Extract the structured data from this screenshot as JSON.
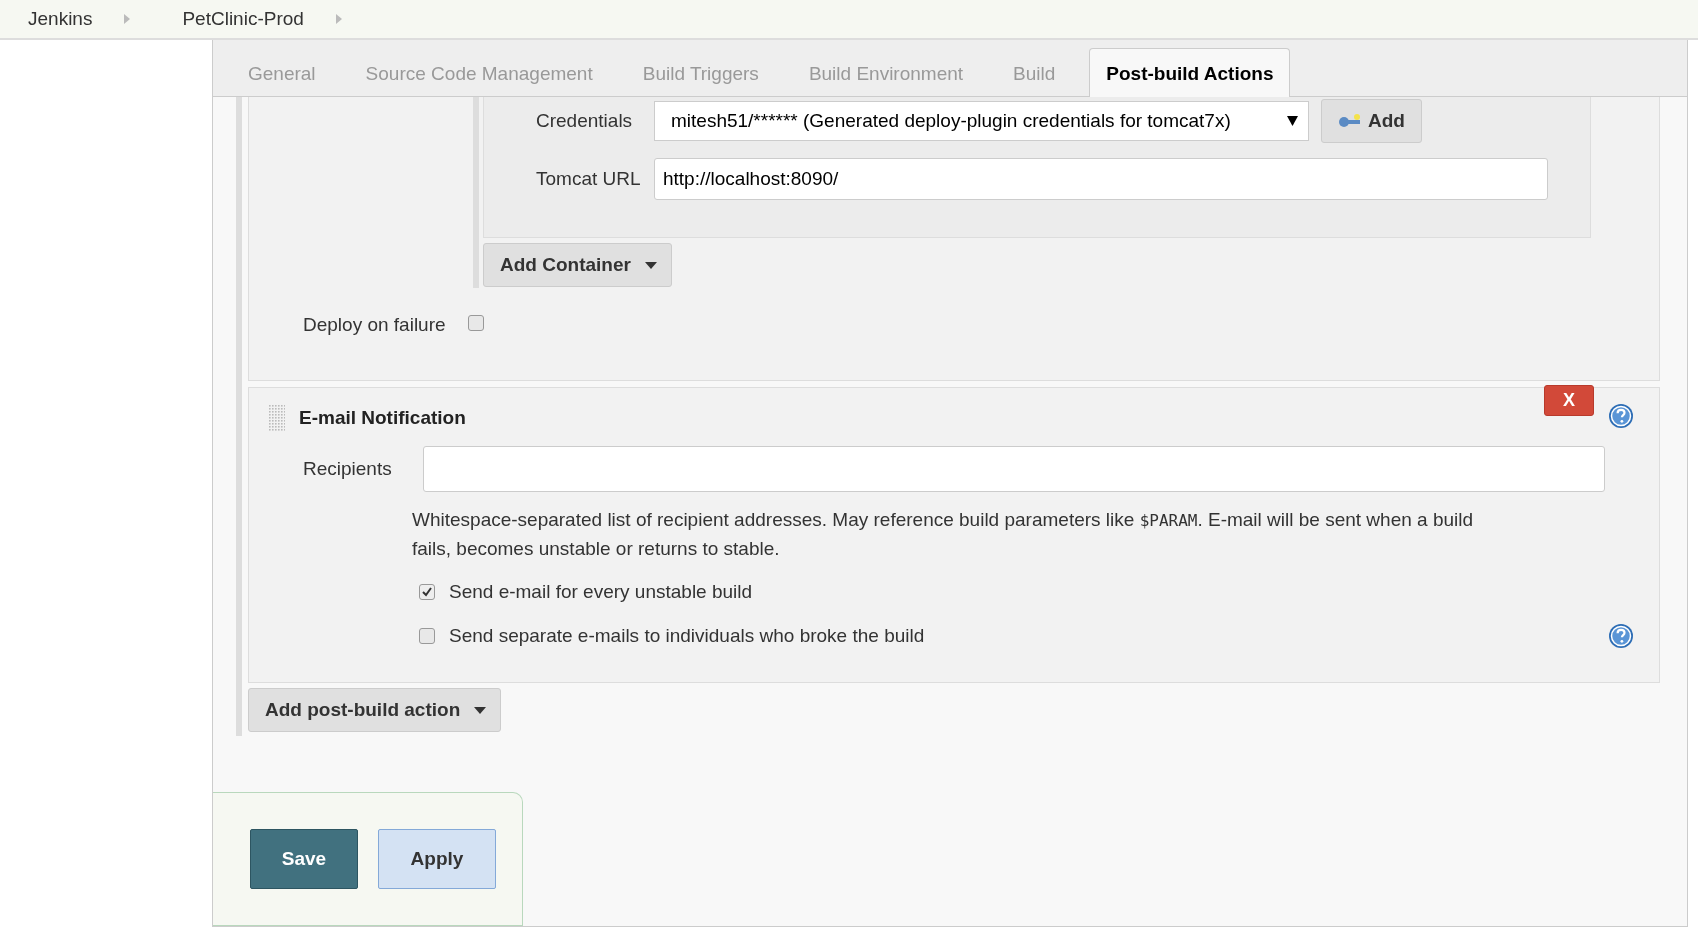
{
  "breadcrumbs": [
    {
      "label": "Jenkins"
    },
    {
      "label": "PetClinic-Prod"
    }
  ],
  "tabs": [
    {
      "label": "General",
      "selected": false
    },
    {
      "label": "Source Code Management",
      "selected": false
    },
    {
      "label": "Build Triggers",
      "selected": false
    },
    {
      "label": "Build Environment",
      "selected": false
    },
    {
      "label": "Build",
      "selected": false
    },
    {
      "label": "Post-build Actions",
      "selected": true
    }
  ],
  "deploy": {
    "credentials": {
      "label": "Credentials",
      "value": "mitesh51/****** (Generated deploy-plugin credentials for tomcat7x)",
      "add_button": "Add"
    },
    "tomcat_url": {
      "label": "Tomcat URL",
      "value": "http://localhost:8090/"
    },
    "add_container_button": "Add Container",
    "deploy_on_failure": {
      "label": "Deploy on failure",
      "checked": false
    }
  },
  "email": {
    "title": "E-mail Notification",
    "delete_button": "X",
    "recipients": {
      "label": "Recipients"
    },
    "help_text": [
      {
        "kind": "text",
        "text": "Whitespace-separated list of recipient addresses. May reference build parameters like "
      },
      {
        "kind": "code",
        "text": "$PARAM"
      },
      {
        "kind": "text",
        "text": ". E-mail will be sent when a build fails, becomes unstable or returns to stable."
      }
    ],
    "options": [
      {
        "label": "Send e-mail for every unstable build",
        "checked": true,
        "help": false
      },
      {
        "label": "Send separate e-mails to individuals who broke the build",
        "checked": false,
        "help": true
      }
    ]
  },
  "add_post_build_button": "Add post-build action",
  "buttons": [
    {
      "label": "Save",
      "kind": "primary"
    },
    {
      "label": "Apply",
      "kind": "secondary"
    }
  ]
}
